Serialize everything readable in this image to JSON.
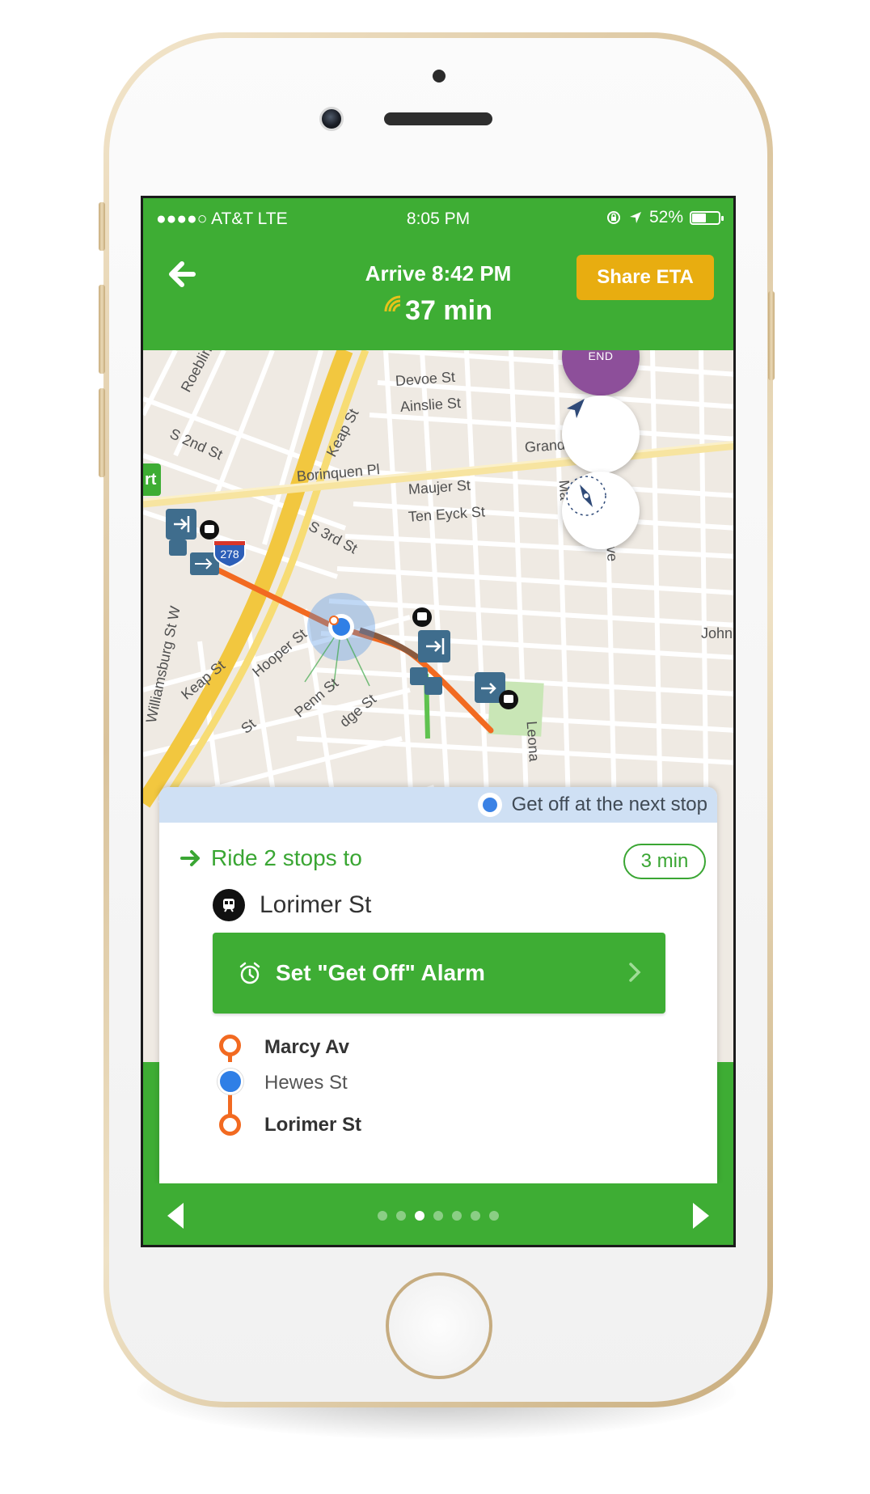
{
  "status_bar": {
    "carrier": "●●●●○ AT&T  LTE",
    "time": "8:05 PM",
    "battery": "52%",
    "battery_level": 0.52
  },
  "header": {
    "arrive_label": "Arrive 8:42 PM",
    "eta": "37 min",
    "share_label": "Share ETA"
  },
  "map": {
    "end_label": "END",
    "highway_shield": "278",
    "streets": [
      "Roebling",
      "S 2nd St",
      "Keap St",
      "Devoe St",
      "Ainslie St",
      "Grand",
      "Borinquen Pl",
      "Maujer St",
      "Ten Eyck St",
      "S 3rd St",
      "Williamsburg St W",
      "Hooper St",
      "Keap St",
      "Penn St",
      "dge St",
      "St",
      "Leona",
      "John",
      "Ma",
      "Ave",
      "rt"
    ]
  },
  "card": {
    "banner": "Get off at the next stop",
    "ride_text": "Ride 2 stops to",
    "duration": "3 min",
    "station": "Lorimer St",
    "alarm_label": "Set \"Get Off\" Alarm",
    "stops": [
      "Marcy Av",
      "Hewes St",
      "Lorimer St"
    ]
  },
  "footer": {
    "page_count": 7,
    "active_page": 2
  },
  "colors": {
    "green": "#3ead34",
    "orange": "#f26a21",
    "purple": "#8d4f9a",
    "yellow": "#e8ad10",
    "blue": "#2f7fe6"
  }
}
